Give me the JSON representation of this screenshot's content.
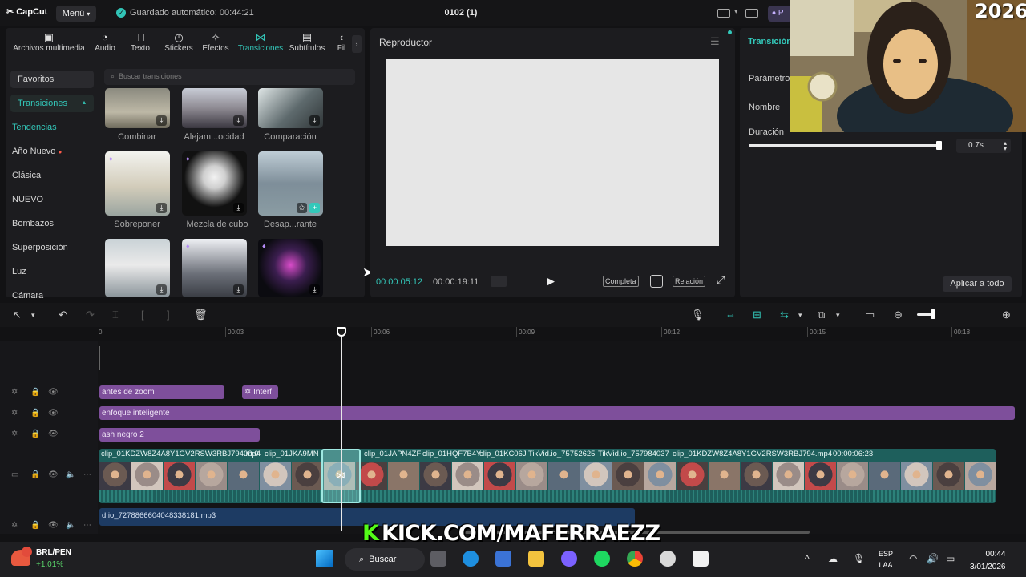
{
  "app": {
    "logo_text": "CapCut",
    "menu_label": "Menú",
    "autosave": "Guardado automático: 00:44:21",
    "project_title": "0102 (1)"
  },
  "media_tabs": [
    {
      "label": "Archivos multimedia",
      "icon": "media-icon"
    },
    {
      "label": "Audio",
      "icon": "audio-icon"
    },
    {
      "label": "Texto",
      "icon": "text-icon"
    },
    {
      "label": "Stickers",
      "icon": "sticker-icon"
    },
    {
      "label": "Efectos",
      "icon": "effects-icon"
    },
    {
      "label": "Transiciones",
      "icon": "transitions-icon",
      "active": true
    },
    {
      "label": "Subtítulos",
      "icon": "subtitles-icon"
    },
    {
      "label": "Fil",
      "icon": "filters-icon"
    }
  ],
  "categories": [
    "Favoritos",
    "Transiciones",
    "Tendencias",
    "Año Nuevo",
    "Clásica",
    "NUEVO",
    "Bombazos",
    "Superposición",
    "Luz",
    "Cámara"
  ],
  "search_placeholder": "Buscar transiciones",
  "transitions": [
    {
      "label": "Combinar"
    },
    {
      "label": "Alejam...ocidad"
    },
    {
      "label": "Comparación"
    },
    {
      "label": "Sobreponer"
    },
    {
      "label": "Mezcla de cubo"
    },
    {
      "label": "Desap...rante"
    }
  ],
  "player": {
    "title": "Reproductor",
    "current_time": "00:00:05:12",
    "total_time": "00:00:19:11",
    "btn_full": "Completa",
    "btn_ratio": "Relación"
  },
  "details": {
    "title": "Transición",
    "params_label": "Parámetros",
    "name_label": "Nombre",
    "duration_label": "Duración",
    "duration_value": "0.7s",
    "duration_fraction": 0.997,
    "apply_all": "Aplicar a todo"
  },
  "ruler": [
    "0",
    "00:03",
    "00:06",
    "00:09",
    "00:12",
    "00:15",
    "00:18"
  ],
  "effect_clips": {
    "zoom": "antes de zoom",
    "inter": "Interf",
    "focus": "enfoque inteligente",
    "flash": "ash negro 2"
  },
  "video_clips": [
    "clip_01KDZW8Z4A8Y1GV2RSW3RBJ794.mp4",
    "00:0",
    "clip_01JKA9MN",
    "clip_01JAPN4ZF",
    "clip_01HQF7B4Y",
    "clip_01KC06J",
    "TikVid.io_75752625",
    "TikVid.io_757984037",
    "clip_01KDZW8Z4A8Y1GV2RSW3RBJ794.mp4",
    "00:00:06:23"
  ],
  "audio_clip": "d.io_7278866604048338181.mp3",
  "banner": {
    "k": "K",
    "text": "KICK.COM/MAFERRAEZZ"
  },
  "taskbar": {
    "currency": "BRL/PEN",
    "change": "+1.01%",
    "search": "Buscar",
    "lang1": "ESP",
    "lang2": "LAA",
    "time": "00:44",
    "date": "3/01/2026"
  },
  "colors": {
    "accent": "#33c8ba",
    "effect_clip": "#7e4f9b",
    "video_track": "#1e5f5c",
    "audio_track": "#1d3b63",
    "kick_green": "#53fc18"
  }
}
